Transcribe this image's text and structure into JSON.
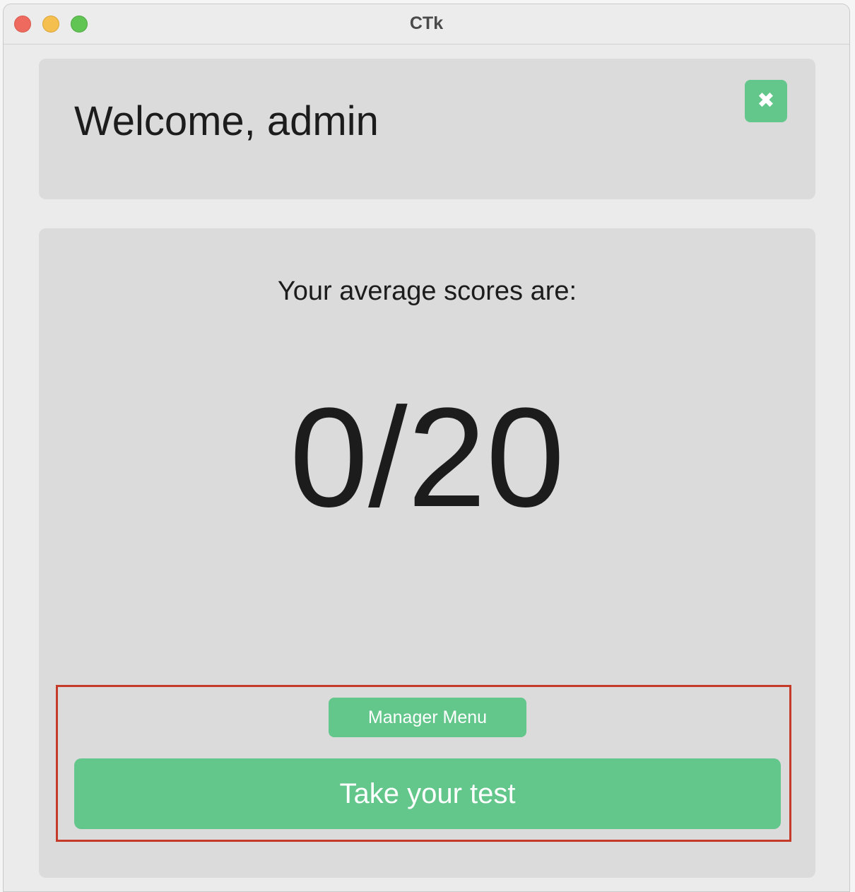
{
  "window": {
    "title": "CTk"
  },
  "header": {
    "welcome_text": "Welcome, admin",
    "close_button_icon": "close-x-icon",
    "close_button_glyph": "✖"
  },
  "main": {
    "average_label": "Your average scores are:",
    "score_value": "0/20",
    "manager_menu_label": "Manager Menu",
    "take_test_label": "Take your test"
  },
  "colors": {
    "accent_green": "#63c68b",
    "card_background": "#dbdbdb",
    "window_background": "#ebebeb",
    "highlight_border": "#c63a2a"
  }
}
